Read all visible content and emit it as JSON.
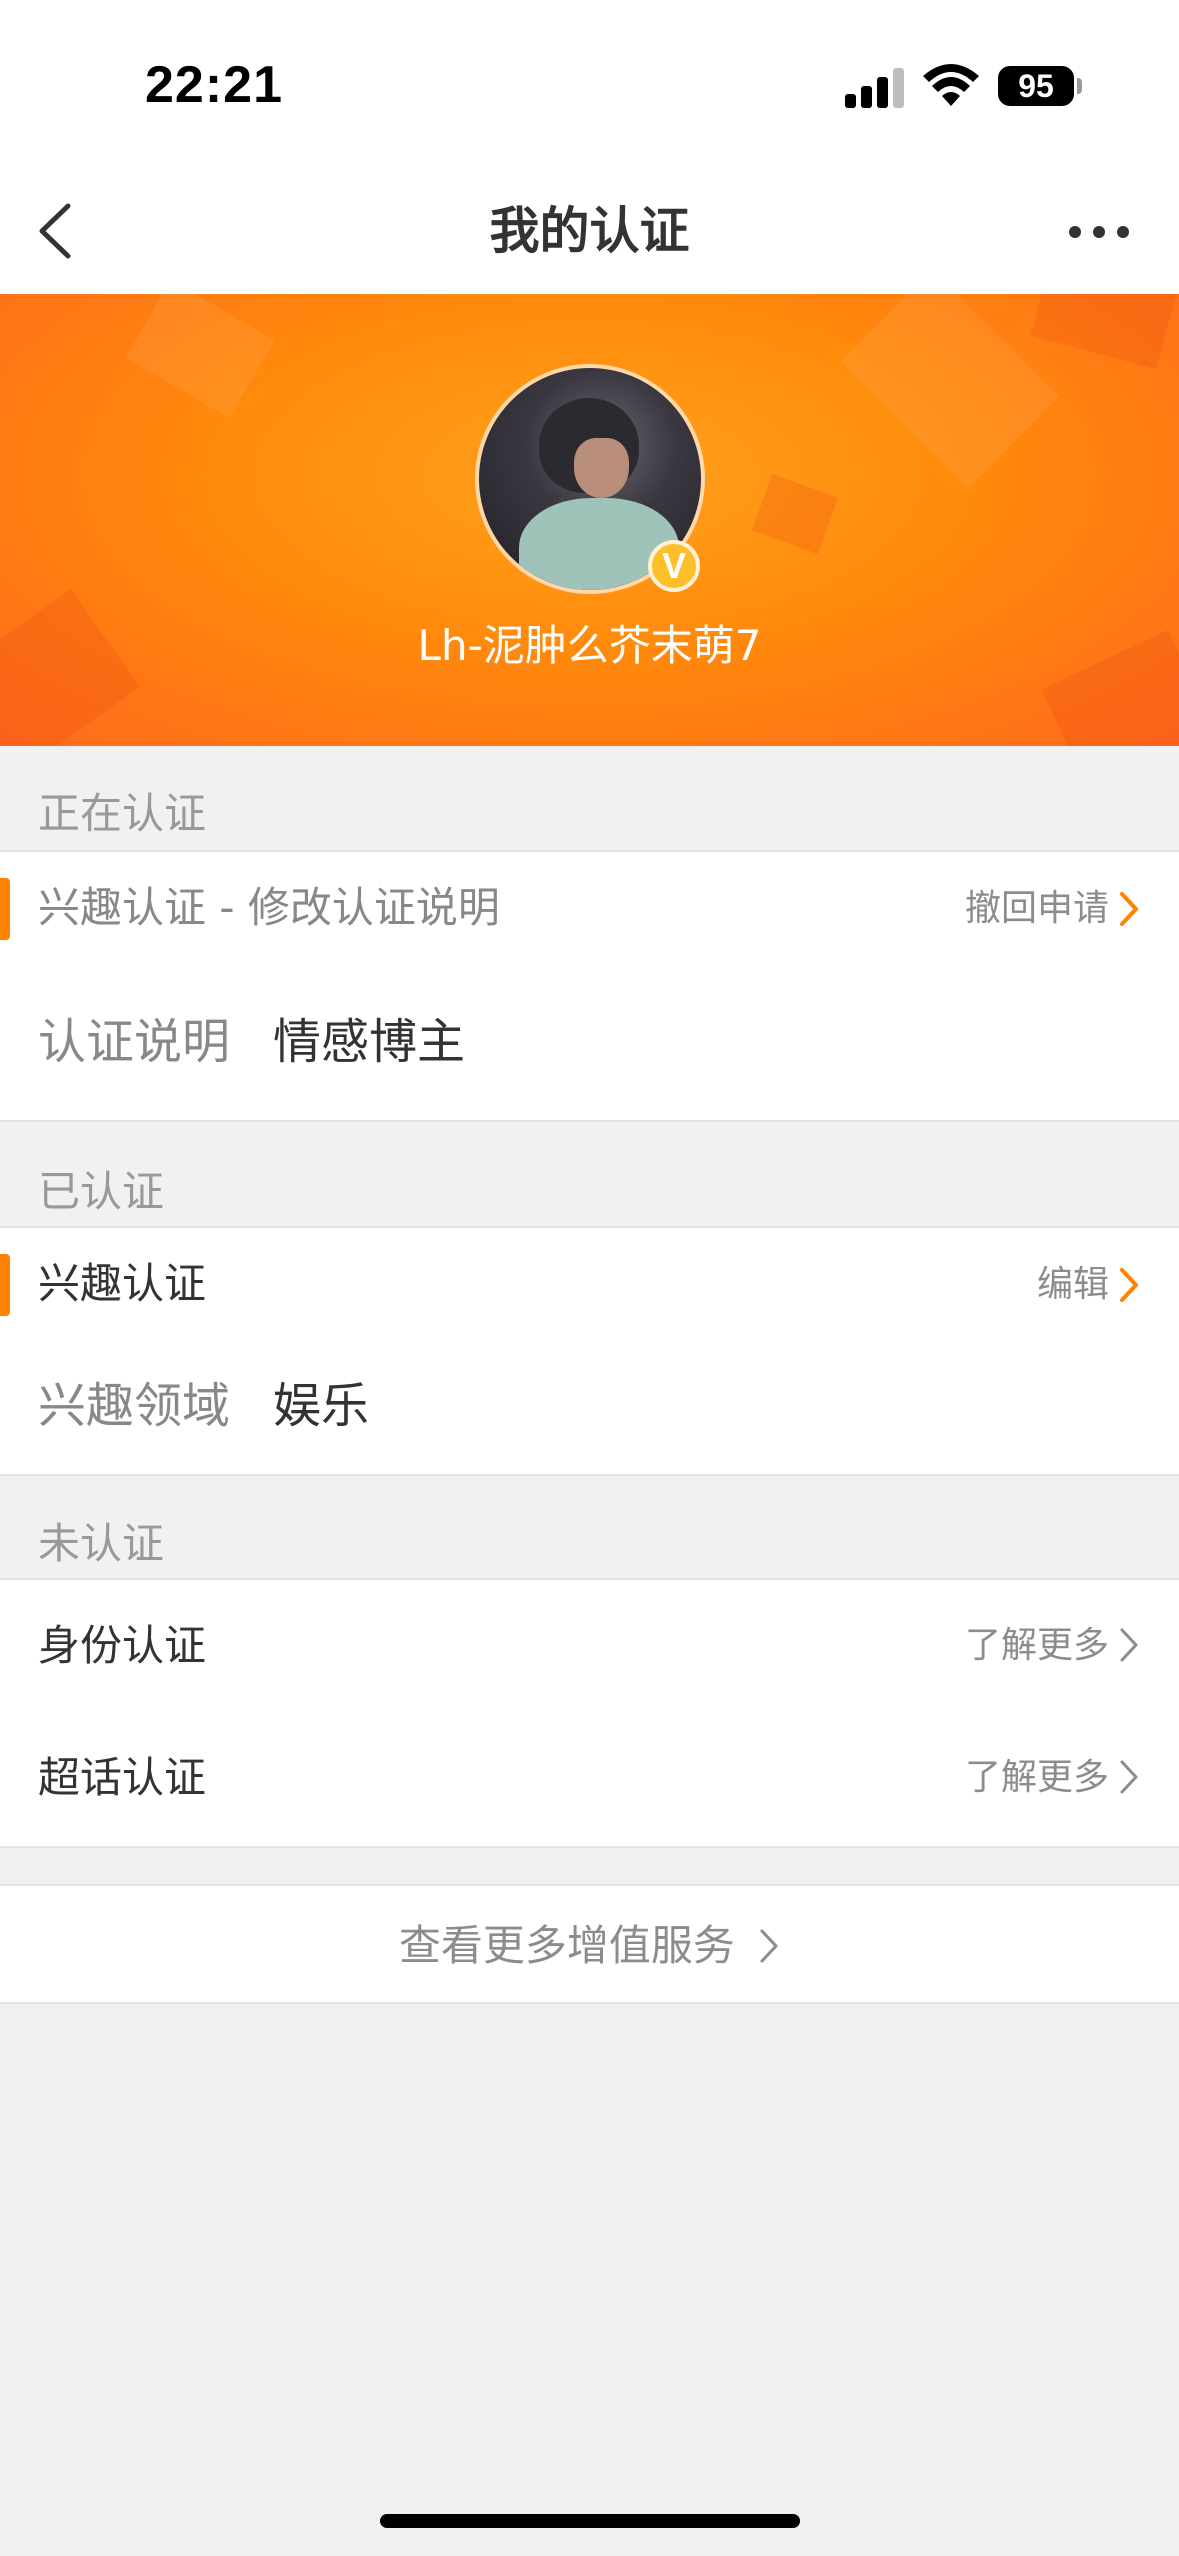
{
  "status_bar": {
    "time": "22:21",
    "battery": "95"
  },
  "nav": {
    "title": "我的认证"
  },
  "profile": {
    "username": "Lh-泥肿么芥末萌7",
    "badge": "V"
  },
  "sections": {
    "in_progress": {
      "header": "正在认证",
      "item_title": "兴趣认证 - 修改认证说明",
      "item_action": "撤回申请",
      "detail_label": "认证说明",
      "detail_value": "情感博主"
    },
    "verified": {
      "header": "已认证",
      "item_title": "兴趣认证",
      "item_action": "编辑",
      "detail_label": "兴趣领域",
      "detail_value": "娱乐"
    },
    "unverified": {
      "header": "未认证",
      "items": [
        {
          "title": "身份认证",
          "action": "了解更多"
        },
        {
          "title": "超话认证",
          "action": "了解更多"
        }
      ]
    }
  },
  "more_services": {
    "label": "查看更多增值服务"
  },
  "colors": {
    "accent": "#ff8200",
    "banner": "#ff8a0c",
    "background": "#f1f1f1"
  },
  "icons": [
    "back-icon",
    "more-icon",
    "verified-badge-icon",
    "chevron-right-icon",
    "signal-icon",
    "wifi-icon",
    "battery-icon"
  ]
}
